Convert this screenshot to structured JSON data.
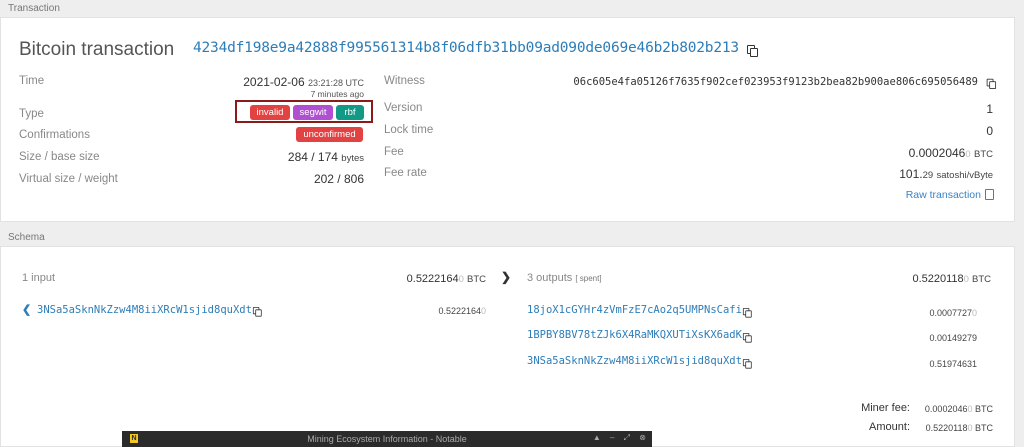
{
  "sections": {
    "transaction": "Transaction",
    "schema": "Schema"
  },
  "header": {
    "title": "Bitcoin transaction",
    "txid": "4234df198e9a42888f995561314b8f06dfb31bb09ad090de069e46b2b802b213"
  },
  "left": {
    "time_label": "Time",
    "time_date": "2021-02-06",
    "time_clock": "23:21:28 UTC",
    "time_ago": "7 minutes ago",
    "type_label": "Type",
    "badges": [
      "invalid",
      "segwit",
      "rbf"
    ],
    "confirmations_label": "Confirmations",
    "confirmations_value": "unconfirmed",
    "size_label": "Size / base size",
    "size_value": "284 / 174",
    "size_unit": "bytes",
    "vsize_label": "Virtual size / weight",
    "vsize_value": "202 / 806"
  },
  "right": {
    "witness_label": "Witness",
    "witness_value": "06c605e4fa05126f7635f902cef023953f9123b2bea82b900ae806c695056489",
    "version_label": "Version",
    "version_value": "1",
    "locktime_label": "Lock time",
    "locktime_value": "0",
    "fee_label": "Fee",
    "fee_main": "0.0002046",
    "fee_ghost": "0",
    "fee_unit": "BTC",
    "feerate_label": "Fee rate",
    "feerate_main": "101.",
    "feerate_small": "29",
    "feerate_unit": "satoshi/vByte",
    "raw_link": "Raw transaction"
  },
  "schema": {
    "inputs_label": "1 input",
    "inputs_total_main": "0.5222164",
    "inputs_total_ghost": "0",
    "inputs_unit": "BTC",
    "outputs_label": "3 outputs",
    "outputs_tag": "[ spent]",
    "outputs_total_main": "0.5220118",
    "outputs_total_ghost": "0",
    "outputs_unit": "BTC",
    "inputs": [
      {
        "address": "3NSa5aSknNkZzw4M8iiXRcW1sjid8quXdt",
        "amount_main": "0.5222164",
        "amount_ghost": "0"
      }
    ],
    "outputs": [
      {
        "address": "18joX1cGYHr4zVmFzE7cAo2q5UMPNsCafi",
        "amount_main": "0.0007727",
        "amount_ghost": "0"
      },
      {
        "address": "1BPBY8BV78tZJk6X4RaMKQXUTiXsKX6adK",
        "amount_main": "0.00149279",
        "amount_ghost": ""
      },
      {
        "address": "3NSa5aSknNkZzw4M8iiXRcW1sjid8quXdt",
        "amount_main": "0.51974631",
        "amount_ghost": ""
      }
    ],
    "miner_fee_label": "Miner fee:",
    "miner_fee_main": "0.0002046",
    "miner_fee_ghost": "0",
    "miner_fee_unit": "BTC",
    "amount_label": "Amount:",
    "amount_main": "0.5220118",
    "amount_ghost": "0",
    "amount_unit": "BTC"
  },
  "notable_window": {
    "title": "Mining Ecosystem Information - Notable",
    "logo": "N"
  },
  "colors": {
    "link": "#2d7db8",
    "invalid": "#e24242",
    "segwit": "#b14fd3",
    "rbf": "#139a87",
    "highlight": "#8b1a1a"
  }
}
